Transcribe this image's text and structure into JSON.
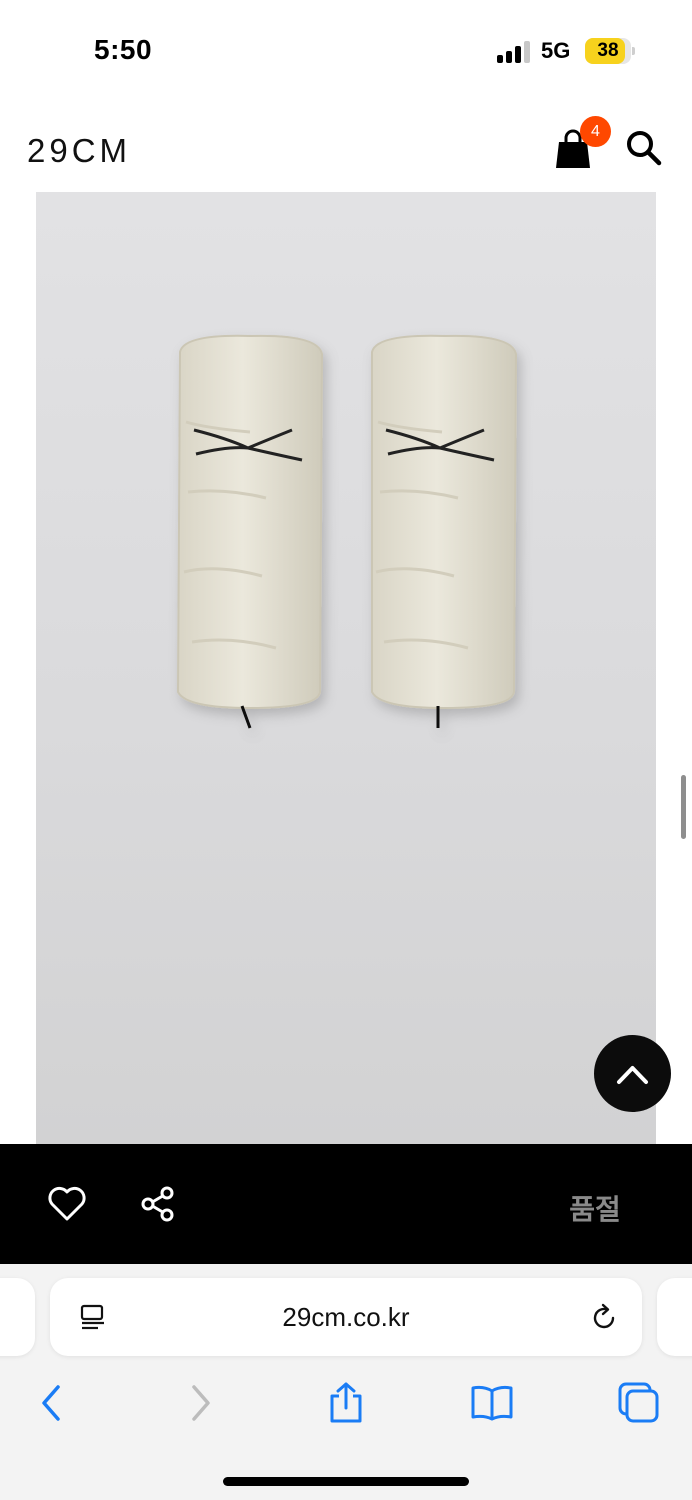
{
  "status_bar": {
    "time": "5:50",
    "network": "5G",
    "battery": "38"
  },
  "header": {
    "logo": "29CM",
    "cart_count": "4",
    "icons": [
      "shopping-bag-icon",
      "search-icon"
    ]
  },
  "product": {
    "image": "faux-fur-leg-warmers-pair"
  },
  "actions": {
    "icons": [
      "heart-icon",
      "share-icon"
    ],
    "sold_out_label": "품절"
  },
  "browser": {
    "url": "29cm.co.kr",
    "icons": [
      "reader-icon",
      "reload-icon",
      "back-icon",
      "forward-icon",
      "share-icon",
      "bookmarks-icon",
      "tabs-icon"
    ]
  },
  "colors": {
    "badge": "#ff4800",
    "action_bar": "#000000",
    "sold_out_text": "#8a8a8a",
    "browser_accent": "#1a7cf5"
  }
}
